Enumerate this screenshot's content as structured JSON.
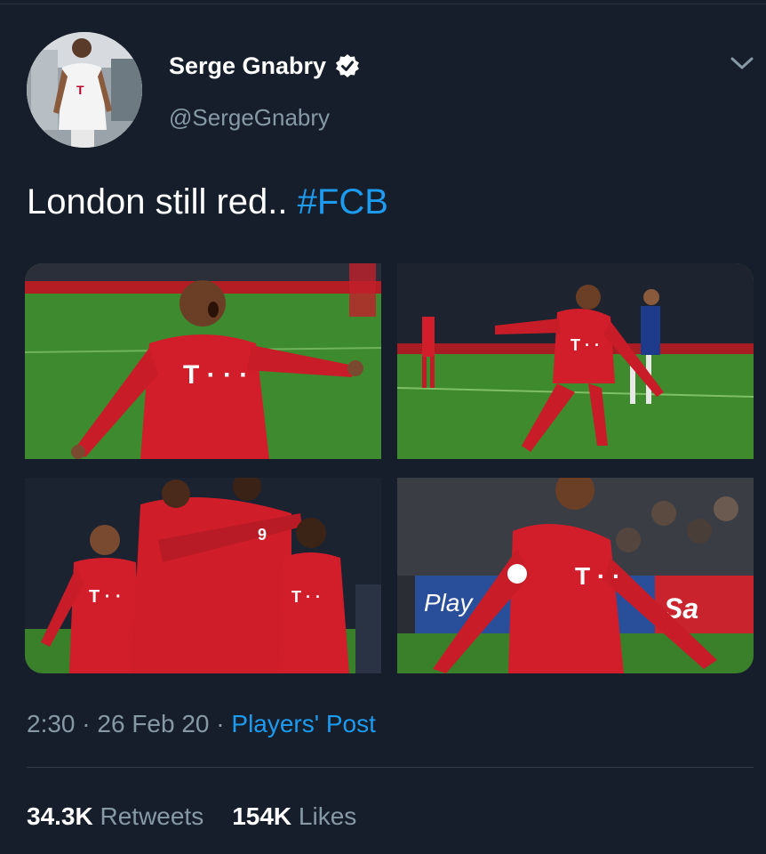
{
  "profile": {
    "display_name": "Serge Gnabry",
    "handle": "@SergeGnabry",
    "verified": true,
    "avatar_icon": "profile-photo"
  },
  "tweet": {
    "text": "London still red.. ",
    "hashtag": "#FCB"
  },
  "media": {
    "photos": [
      {
        "name": "photo-celebration-arms-out"
      },
      {
        "name": "photo-running-celebration"
      },
      {
        "name": "photo-team-hug"
      },
      {
        "name": "photo-closeup-shout"
      }
    ]
  },
  "meta": {
    "time": "2:30",
    "sep1": " · ",
    "date": "26 Feb 20",
    "sep2": " · ",
    "source": "Players' Post"
  },
  "stats": {
    "retweets_count": "34.3K",
    "retweets_label": " Retweets",
    "likes_count": "154K",
    "likes_label": " Likes"
  },
  "colors": {
    "background": "#151e2a",
    "accent": "#1d9bf0",
    "secondary_text": "#8899a6",
    "jersey_red": "#d21e2b",
    "pitch_green": "#3f8a2d"
  }
}
